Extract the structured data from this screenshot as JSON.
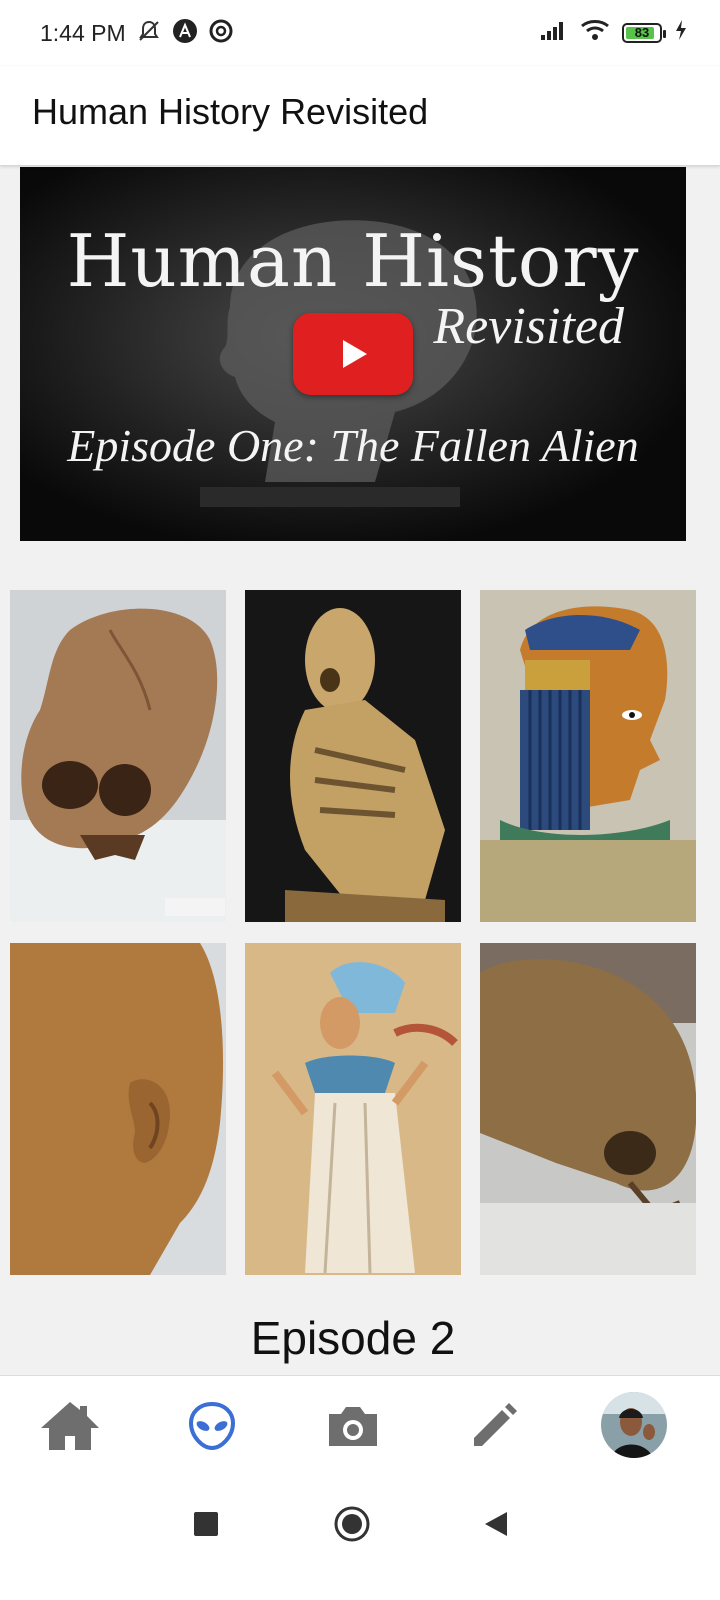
{
  "status_bar": {
    "time": "1:44 PM",
    "battery": "83",
    "icons": [
      "mute-icon",
      "a-badge-icon",
      "at-sign-icon",
      "signal-icon",
      "wifi-icon",
      "battery-icon",
      "charging-icon"
    ]
  },
  "app_bar": {
    "title": "Human History Revisited"
  },
  "video": {
    "title_line1": "Human History",
    "title_line2": "Revisited",
    "subtitle": "Episode One: The Fallen Alien",
    "play_icon": "youtube-play-icon",
    "colors": {
      "play": "#e02020",
      "text": "#f4f4f4"
    }
  },
  "gallery": {
    "images": [
      {
        "name": "elongated-skull-photo"
      },
      {
        "name": "mummy-photo"
      },
      {
        "name": "egyptian-relief-profile"
      },
      {
        "name": "sculpture-head-closeup"
      },
      {
        "name": "egyptian-princess-relief"
      },
      {
        "name": "paracas-skull-photo"
      }
    ]
  },
  "episode_heading": "Episode 2",
  "bottom_nav": {
    "items": [
      "home-icon",
      "alien-icon",
      "camera-icon",
      "pencil-icon",
      "avatar"
    ],
    "active": "alien-icon",
    "colors": {
      "active": "#3b6fd6",
      "inactive": "#6e6e6e"
    }
  },
  "system_nav": {
    "buttons": [
      "recents-icon",
      "home-circle-icon",
      "back-icon"
    ]
  }
}
